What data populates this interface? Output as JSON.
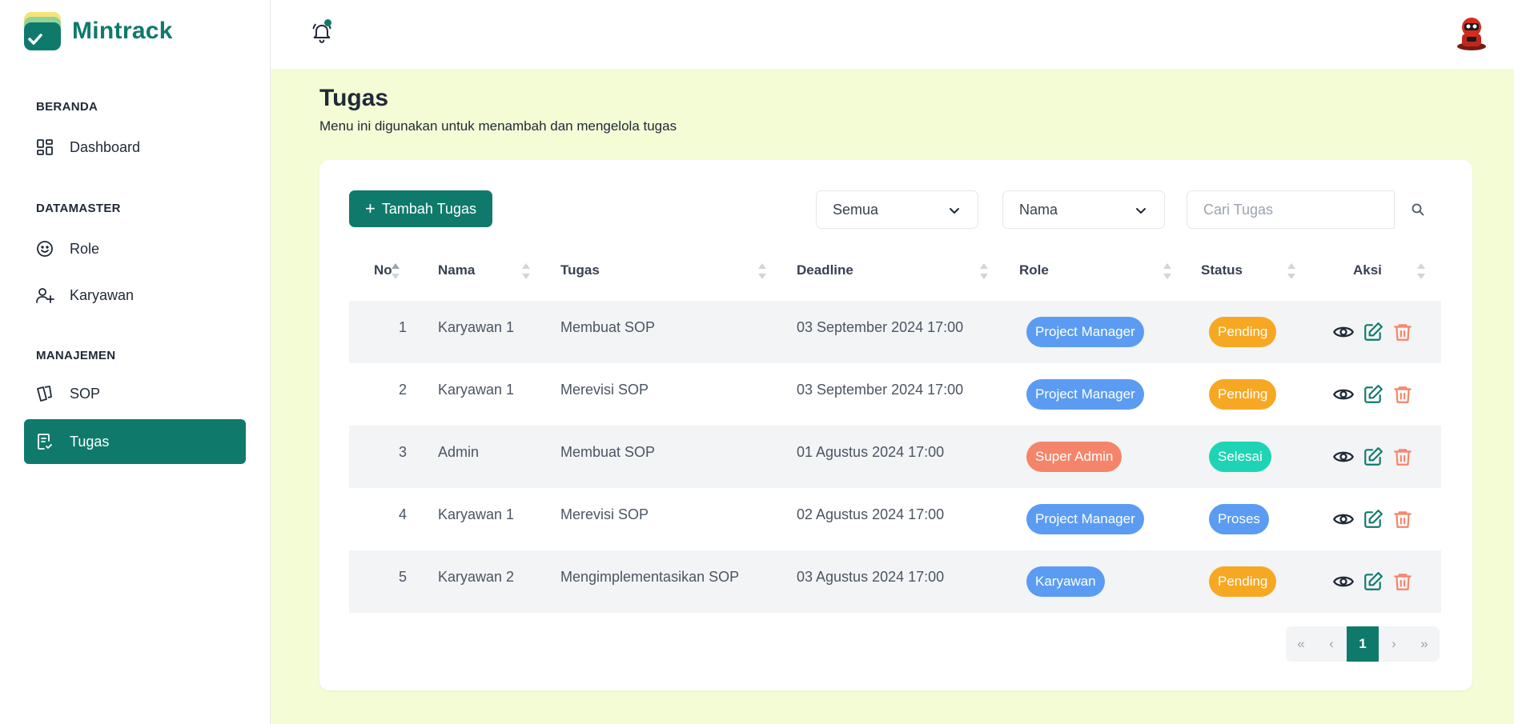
{
  "app": {
    "name": "Mintrack",
    "brand_color": "#0f7a6c"
  },
  "sidebar": {
    "sections": [
      {
        "title": "BERANDA",
        "items": [
          {
            "label": "Dashboard",
            "icon": "dashboard-grid-icon"
          }
        ]
      },
      {
        "title": "DATAMASTER",
        "items": [
          {
            "label": "Role",
            "icon": "smile-face-icon"
          },
          {
            "label": "Karyawan",
            "icon": "user-plus-icon"
          }
        ]
      },
      {
        "title": "MANAJEMEN",
        "items": [
          {
            "label": "SOP",
            "icon": "cards-icon"
          },
          {
            "label": "Tugas",
            "icon": "task-list-icon",
            "active": true
          }
        ]
      }
    ]
  },
  "topbar": {
    "notification_icon": "bell-icon",
    "has_unread": true,
    "avatar_icon": "user-avatar-icon"
  },
  "page": {
    "title": "Tugas",
    "subtitle": "Menu ini digunakan untuk menambah dan mengelola tugas"
  },
  "toolbar": {
    "add_label": "Tambah Tugas",
    "filter_status": "Semua",
    "filter_field": "Nama",
    "search_placeholder": "Cari Tugas"
  },
  "table": {
    "columns": [
      "No",
      "Nama",
      "Tugas",
      "Deadline",
      "Role",
      "Status",
      "Aksi"
    ],
    "rows": [
      {
        "no": "1",
        "nama": "Karyawan 1",
        "tugas": "Membuat SOP",
        "deadline": "03 September 2024 17:00",
        "role": "Project Manager",
        "status": "Pending"
      },
      {
        "no": "2",
        "nama": "Karyawan 1",
        "tugas": "Merevisi SOP",
        "deadline": "03 September 2024 17:00",
        "role": "Project Manager",
        "status": "Pending"
      },
      {
        "no": "3",
        "nama": "Admin",
        "tugas": "Membuat SOP",
        "deadline": "01 Agustus 2024 17:00",
        "role": "Super Admin",
        "status": "Selesai"
      },
      {
        "no": "4",
        "nama": "Karyawan 1",
        "tugas": "Merevisi SOP",
        "deadline": "02 Agustus 2024 17:00",
        "role": "Project Manager",
        "status": "Proses"
      },
      {
        "no": "5",
        "nama": "Karyawan 2",
        "tugas": "Mengimplementasikan SOP",
        "deadline": "03 Agustus 2024 17:00",
        "role": "Karyawan",
        "status": "Pending"
      }
    ],
    "role_colors": {
      "Project Manager": "#5b9cf2",
      "Super Admin": "#f4856a",
      "Karyawan": "#5b9cf2"
    },
    "status_colors": {
      "Pending": "#f7a823",
      "Selesai": "#1fd4b4",
      "Proses": "#5b9cf2"
    }
  },
  "pagination": {
    "first": "«",
    "prev": "‹",
    "current": "1",
    "next": "›",
    "last": "»"
  }
}
